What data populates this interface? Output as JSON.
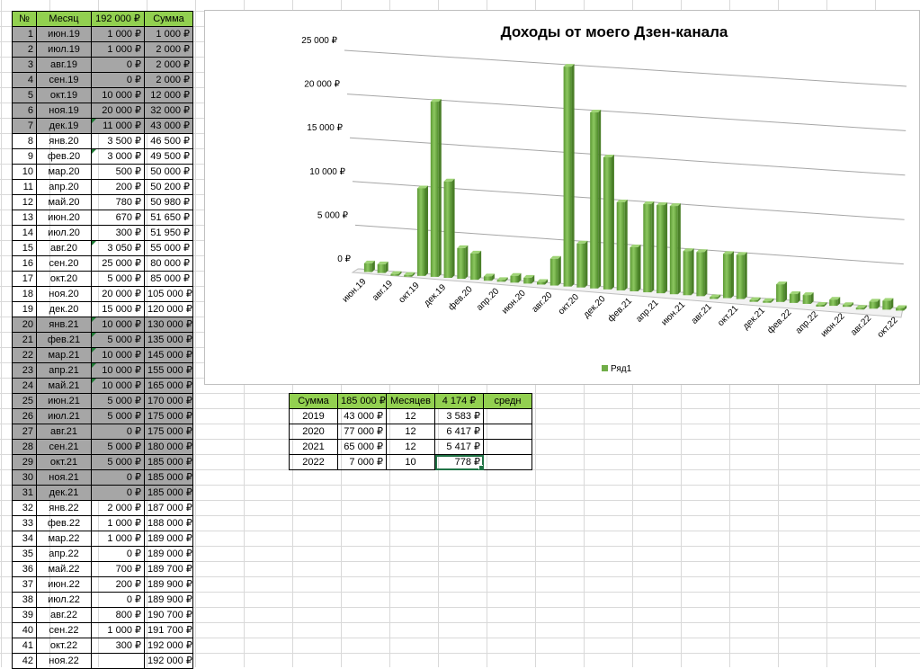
{
  "main_table": {
    "headers": [
      "№",
      "Месяц",
      "192 000 ₽",
      "Сумма"
    ],
    "rows": [
      {
        "n": "1",
        "month": "июн.19",
        "amount": "1 000 ₽",
        "sum": "1 000 ₽",
        "gray": true,
        "tri": false
      },
      {
        "n": "2",
        "month": "июл.19",
        "amount": "1 000 ₽",
        "sum": "2 000 ₽",
        "gray": true,
        "tri": false
      },
      {
        "n": "3",
        "month": "авг.19",
        "amount": "0 ₽",
        "sum": "2 000 ₽",
        "gray": true,
        "tri": false
      },
      {
        "n": "4",
        "month": "сен.19",
        "amount": "0 ₽",
        "sum": "2 000 ₽",
        "gray": true,
        "tri": false
      },
      {
        "n": "5",
        "month": "окт.19",
        "amount": "10 000 ₽",
        "sum": "12 000 ₽",
        "gray": true,
        "tri": false
      },
      {
        "n": "6",
        "month": "ноя.19",
        "amount": "20 000 ₽",
        "sum": "32 000 ₽",
        "gray": true,
        "tri": false
      },
      {
        "n": "7",
        "month": "дек.19",
        "amount": "11 000 ₽",
        "sum": "43 000 ₽",
        "gray": true,
        "tri": true
      },
      {
        "n": "8",
        "month": "янв.20",
        "amount": "3 500 ₽",
        "sum": "46 500 ₽",
        "gray": false,
        "tri": false
      },
      {
        "n": "9",
        "month": "фев.20",
        "amount": "3 000 ₽",
        "sum": "49 500 ₽",
        "gray": false,
        "tri": true
      },
      {
        "n": "10",
        "month": "мар.20",
        "amount": "500 ₽",
        "sum": "50 000 ₽",
        "gray": false,
        "tri": false
      },
      {
        "n": "11",
        "month": "апр.20",
        "amount": "200 ₽",
        "sum": "50 200 ₽",
        "gray": false,
        "tri": false
      },
      {
        "n": "12",
        "month": "май.20",
        "amount": "780 ₽",
        "sum": "50 980 ₽",
        "gray": false,
        "tri": false
      },
      {
        "n": "13",
        "month": "июн.20",
        "amount": "670 ₽",
        "sum": "51 650 ₽",
        "gray": false,
        "tri": false
      },
      {
        "n": "14",
        "month": "июл.20",
        "amount": "300 ₽",
        "sum": "51 950 ₽",
        "gray": false,
        "tri": false
      },
      {
        "n": "15",
        "month": "авг.20",
        "amount": "3 050 ₽",
        "sum": "55 000 ₽",
        "gray": false,
        "tri": true
      },
      {
        "n": "16",
        "month": "сен.20",
        "amount": "25 000 ₽",
        "sum": "80 000 ₽",
        "gray": false,
        "tri": false
      },
      {
        "n": "17",
        "month": "окт.20",
        "amount": "5 000 ₽",
        "sum": "85 000 ₽",
        "gray": false,
        "tri": false
      },
      {
        "n": "18",
        "month": "ноя.20",
        "amount": "20 000 ₽",
        "sum": "105 000 ₽",
        "gray": false,
        "tri": false
      },
      {
        "n": "19",
        "month": "дек.20",
        "amount": "15 000 ₽",
        "sum": "120 000 ₽",
        "gray": false,
        "tri": false
      },
      {
        "n": "20",
        "month": "янв.21",
        "amount": "10 000 ₽",
        "sum": "130 000 ₽",
        "gray": true,
        "tri": true
      },
      {
        "n": "21",
        "month": "фев.21",
        "amount": "5 000 ₽",
        "sum": "135 000 ₽",
        "gray": true,
        "tri": true
      },
      {
        "n": "22",
        "month": "мар.21",
        "amount": "10 000 ₽",
        "sum": "145 000 ₽",
        "gray": true,
        "tri": true
      },
      {
        "n": "23",
        "month": "апр.21",
        "amount": "10 000 ₽",
        "sum": "155 000 ₽",
        "gray": true,
        "tri": true
      },
      {
        "n": "24",
        "month": "май.21",
        "amount": "10 000 ₽",
        "sum": "165 000 ₽",
        "gray": true,
        "tri": true
      },
      {
        "n": "25",
        "month": "июн.21",
        "amount": "5 000 ₽",
        "sum": "170 000 ₽",
        "gray": true,
        "tri": false
      },
      {
        "n": "26",
        "month": "июл.21",
        "amount": "5 000 ₽",
        "sum": "175 000 ₽",
        "gray": true,
        "tri": false
      },
      {
        "n": "27",
        "month": "авг.21",
        "amount": "0 ₽",
        "sum": "175 000 ₽",
        "gray": true,
        "tri": false
      },
      {
        "n": "28",
        "month": "сен.21",
        "amount": "5 000 ₽",
        "sum": "180 000 ₽",
        "gray": true,
        "tri": false
      },
      {
        "n": "29",
        "month": "окт.21",
        "amount": "5 000 ₽",
        "sum": "185 000 ₽",
        "gray": true,
        "tri": false
      },
      {
        "n": "30",
        "month": "ноя.21",
        "amount": "0 ₽",
        "sum": "185 000 ₽",
        "gray": true,
        "tri": false
      },
      {
        "n": "31",
        "month": "дек.21",
        "amount": "0 ₽",
        "sum": "185 000 ₽",
        "gray": true,
        "tri": false
      },
      {
        "n": "32",
        "month": "янв.22",
        "amount": "2 000 ₽",
        "sum": "187 000 ₽",
        "gray": false,
        "tri": false
      },
      {
        "n": "33",
        "month": "фев.22",
        "amount": "1 000 ₽",
        "sum": "188 000 ₽",
        "gray": false,
        "tri": false
      },
      {
        "n": "34",
        "month": "мар.22",
        "amount": "1 000 ₽",
        "sum": "189 000 ₽",
        "gray": false,
        "tri": false
      },
      {
        "n": "35",
        "month": "апр.22",
        "amount": "0 ₽",
        "sum": "189 000 ₽",
        "gray": false,
        "tri": false
      },
      {
        "n": "36",
        "month": "май.22",
        "amount": "700 ₽",
        "sum": "189 700 ₽",
        "gray": false,
        "tri": false
      },
      {
        "n": "37",
        "month": "июн.22",
        "amount": "200 ₽",
        "sum": "189 900 ₽",
        "gray": false,
        "tri": false
      },
      {
        "n": "38",
        "month": "июл.22",
        "amount": "0 ₽",
        "sum": "189 900 ₽",
        "gray": false,
        "tri": false
      },
      {
        "n": "39",
        "month": "авг.22",
        "amount": "800 ₽",
        "sum": "190 700 ₽",
        "gray": false,
        "tri": false
      },
      {
        "n": "40",
        "month": "сен.22",
        "amount": "1 000 ₽",
        "sum": "191 700 ₽",
        "gray": false,
        "tri": false
      },
      {
        "n": "41",
        "month": "окт.22",
        "amount": "300 ₽",
        "sum": "192 000 ₽",
        "gray": false,
        "tri": false
      },
      {
        "n": "42",
        "month": "ноя.22",
        "amount": "",
        "sum": "192 000 ₽",
        "gray": false,
        "tri": false
      }
    ]
  },
  "summary_table": {
    "headers": [
      "Сумма",
      "185 000 ₽",
      "Месяцев",
      "4 174 ₽",
      "средн"
    ],
    "rows": [
      {
        "year": "2019",
        "total": "43 000 ₽",
        "months": "12",
        "avg": "3 583 ₽"
      },
      {
        "year": "2020",
        "total": "77 000 ₽",
        "months": "12",
        "avg": "6 417 ₽"
      },
      {
        "year": "2021",
        "total": "65 000 ₽",
        "months": "12",
        "avg": "5 417 ₽"
      },
      {
        "year": "2022",
        "total": "7 000 ₽",
        "months": "10",
        "avg": "778 ₽"
      }
    ]
  },
  "chart_data": {
    "type": "bar",
    "title": "Доходы от моего Дзен-канала",
    "series": [
      {
        "name": "Ряд1",
        "values": [
          1000,
          1000,
          0,
          0,
          10000,
          20000,
          11000,
          3500,
          3000,
          500,
          200,
          780,
          670,
          300,
          3050,
          25000,
          5000,
          20000,
          15000,
          10000,
          5000,
          10000,
          10000,
          10000,
          5000,
          5000,
          0,
          5000,
          5000,
          0,
          0,
          2000,
          1000,
          1000,
          0,
          700,
          200,
          0,
          800,
          1000,
          300
        ]
      }
    ],
    "categories": [
      "июн.19",
      "июл.19",
      "авг.19",
      "сен.19",
      "окт.19",
      "ноя.19",
      "дек.19",
      "янв.20",
      "фев.20",
      "мар.20",
      "апр.20",
      "май.20",
      "июн.20",
      "июл.20",
      "авг.20",
      "сен.20",
      "окт.20",
      "ноя.20",
      "дек.20",
      "янв.21",
      "фев.21",
      "мар.21",
      "апр.21",
      "май.21",
      "июн.21",
      "июл.21",
      "авг.21",
      "сен.21",
      "окт.21",
      "ноя.21",
      "дек.21",
      "янв.22",
      "фев.22",
      "мар.22",
      "апр.22",
      "май.22",
      "июн.22",
      "июл.22",
      "авг.22",
      "сен.22",
      "окт.22"
    ],
    "x_tick_labels": [
      "июн.19",
      "авг.19",
      "окт.19",
      "дек.19",
      "фев.20",
      "апр.20",
      "июн.20",
      "авг.20",
      "окт.20",
      "дек.20",
      "фев.21",
      "апр.21",
      "июн.21",
      "авг.21",
      "окт.21",
      "дек.21",
      "фев.22",
      "апр.22",
      "июн.22",
      "авг.22",
      "окт.22"
    ],
    "y_ticks": [
      "0 ₽",
      "5 000 ₽",
      "10 000 ₽",
      "15 000 ₽",
      "20 000 ₽",
      "25 000 ₽"
    ],
    "ylim": [
      0,
      25000
    ],
    "grid": true,
    "legend": "bottom",
    "bar_color": "#70ad47"
  },
  "colors": {
    "header_green": "#92d050",
    "gray_row": "#a6a6a6",
    "bar": "#70ad47"
  }
}
